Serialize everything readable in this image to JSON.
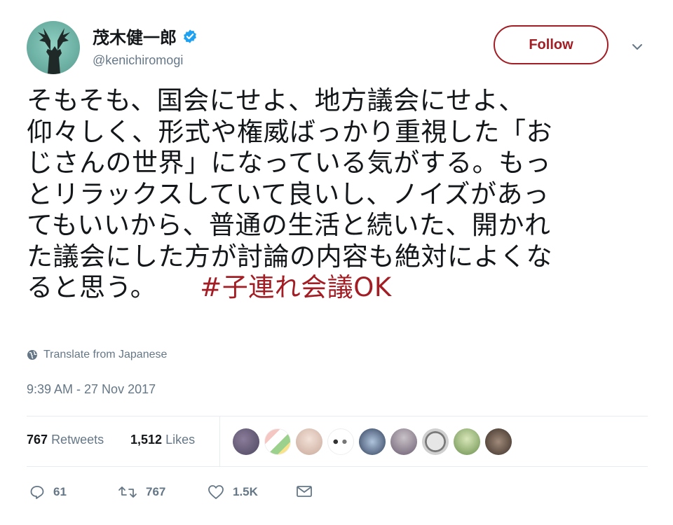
{
  "user": {
    "display_name": "茂木健一郎",
    "handle": "@kenichiromogi",
    "verified": true
  },
  "follow_label": "Follow",
  "tweet": {
    "lines": [
      "そもそも、国会にせよ、地方議会にせよ、",
      "仰々しく、形式や権威ばっかり重視した「お",
      "じさんの世界」になっている気がする。もっ",
      "とリラックスしていて良いし、ノイズがあっ",
      "てもいいから、普通の生活と続いた、開かれ",
      "た議会にした方が討論の内容も絶対によくな",
      "ると思う。"
    ],
    "hashtag": "#子連れ会議OK"
  },
  "translate_label": "Translate from Japanese",
  "timestamp": "9:39 AM - 27 Nov 2017",
  "stats": {
    "retweets_count": "767",
    "retweets_label": "Retweets",
    "likes_count": "1,512",
    "likes_label": "Likes"
  },
  "actions": {
    "replies": "61",
    "retweets": "767",
    "likes": "1.5K"
  },
  "colors": {
    "accent": "#a21d24",
    "muted": "#657786",
    "text": "#14171a",
    "verified": "#1da1f2",
    "divider": "#e6ecf0"
  },
  "icons": [
    "verified-badge-icon",
    "chevron-down-icon",
    "globe-icon",
    "reply-icon",
    "retweet-icon",
    "heart-icon",
    "envelope-icon"
  ]
}
